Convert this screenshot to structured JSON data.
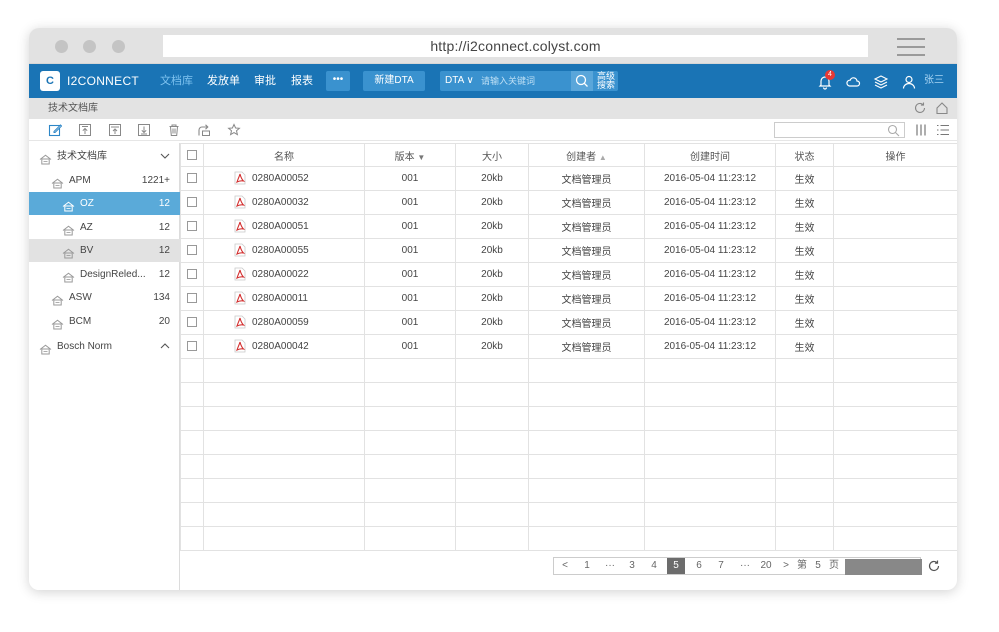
{
  "browser": {
    "url": "http://i2connect.colyst.com"
  },
  "app": {
    "brand": "I2CONNECT",
    "logo_text": "C"
  },
  "nav": {
    "items": [
      "文档库",
      "发放单",
      "审批",
      "报表"
    ],
    "more": "•••",
    "new_button": "新建DTA",
    "search_type": "DTA",
    "search_placeholder": "请输入关键词",
    "advanced_line1": "高级",
    "advanced_line2": "搜索",
    "notification_count": "4",
    "username": "张三"
  },
  "breadcrumb": "技术文档库",
  "tree": [
    {
      "label": "技术文档库",
      "level": 0,
      "count": "",
      "expand": "collapse-down"
    },
    {
      "label": "APM",
      "level": 1,
      "count": "1221+"
    },
    {
      "label": "OZ",
      "level": 2,
      "count": "12",
      "state": "selected"
    },
    {
      "label": "AZ",
      "level": 2,
      "count": "12"
    },
    {
      "label": "BV",
      "level": 2,
      "count": "12",
      "state": "hover"
    },
    {
      "label": "DesignReled...",
      "level": 2,
      "count": "12"
    },
    {
      "label": "ASW",
      "level": 1,
      "count": "134"
    },
    {
      "label": "BCM",
      "level": 1,
      "count": "20"
    },
    {
      "label": "Bosch Norm",
      "level": 0,
      "count": "",
      "expand": "collapse-up"
    }
  ],
  "table": {
    "columns": [
      "名称",
      "版本",
      "大小",
      "创建者",
      "创建时间",
      "状态",
      "操作"
    ],
    "rows": [
      {
        "name": "0280A00052",
        "version": "001",
        "size": "20kb",
        "creator": "文档管理员",
        "created": "2016-05-04 11:23:12",
        "status": "生效"
      },
      {
        "name": "0280A00032",
        "version": "001",
        "size": "20kb",
        "creator": "文档管理员",
        "created": "2016-05-04 11:23:12",
        "status": "生效"
      },
      {
        "name": "0280A00051",
        "version": "001",
        "size": "20kb",
        "creator": "文档管理员",
        "created": "2016-05-04 11:23:12",
        "status": "生效"
      },
      {
        "name": "0280A00055",
        "version": "001",
        "size": "20kb",
        "creator": "文档管理员",
        "created": "2016-05-04 11:23:12",
        "status": "生效"
      },
      {
        "name": "0280A00022",
        "version": "001",
        "size": "20kb",
        "creator": "文档管理员",
        "created": "2016-05-04 11:23:12",
        "status": "生效"
      },
      {
        "name": "0280A00011",
        "version": "001",
        "size": "20kb",
        "creator": "文档管理员",
        "created": "2016-05-04 11:23:12",
        "status": "生效"
      },
      {
        "name": "0280A00059",
        "version": "001",
        "size": "20kb",
        "creator": "文档管理员",
        "created": "2016-05-04 11:23:12",
        "status": "生效"
      },
      {
        "name": "0280A00042",
        "version": "001",
        "size": "20kb",
        "creator": "文档管理员",
        "created": "2016-05-04 11:23:12",
        "status": "生效"
      }
    ],
    "empty_rows": 8
  },
  "pager": {
    "prev": "<",
    "next": ">",
    "pages": [
      "1",
      "···",
      "3",
      "4",
      "5",
      "6",
      "7",
      "···",
      "20"
    ],
    "current": "5",
    "goto_prefix": "第",
    "goto_value": "5",
    "goto_suffix": "页"
  },
  "colors": {
    "nav_bg": "#1a74b5",
    "selected": "#5aaad9",
    "accent": "#3a92cf"
  }
}
